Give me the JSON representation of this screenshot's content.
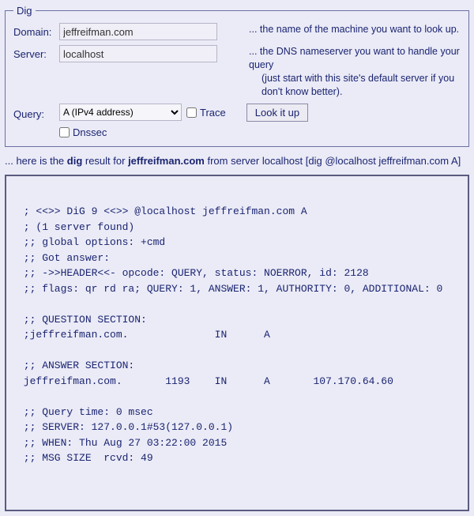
{
  "fieldset": {
    "legend": "Dig"
  },
  "labels": {
    "domain": "Domain:",
    "server": "Server:",
    "query": "Query:"
  },
  "domain": {
    "value": "jeffreifman.com"
  },
  "server": {
    "value": "localhost"
  },
  "query_select": {
    "selected": "A (IPv4 address)"
  },
  "trace": {
    "label": "Trace"
  },
  "dnssec": {
    "label": "Dnssec"
  },
  "lookup_button": "Look it up",
  "hint_domain": "... the name of the machine you want to look up.",
  "hint_server1": "... the DNS nameserver you want to handle your query",
  "hint_server2": "(just start with this site's default server if you don't know better).",
  "result": {
    "prefix": "... here is the ",
    "dig": "dig",
    "mid": " result for ",
    "target": "jeffreifman.com",
    "suffix": " from server localhost [dig @localhost jeffreifman.com A]"
  },
  "output": "\n ; <<>> DiG 9 <<>> @localhost jeffreifman.com A\n ; (1 server found)\n ;; global options: +cmd\n ;; Got answer:\n ;; ->>HEADER<<- opcode: QUERY, status: NOERROR, id: 2128\n ;; flags: qr rd ra; QUERY: 1, ANSWER: 1, AUTHORITY: 0, ADDITIONAL: 0\n\n ;; QUESTION SECTION:\n ;jeffreifman.com.              IN      A\n\n ;; ANSWER SECTION:\n jeffreifman.com.       1193    IN      A       107.170.64.60\n\n ;; Query time: 0 msec\n ;; SERVER: 127.0.0.1#53(127.0.0.1)\n ;; WHEN: Thu Aug 27 03:22:00 2015\n ;; MSG SIZE  rcvd: 49\n \n \n"
}
